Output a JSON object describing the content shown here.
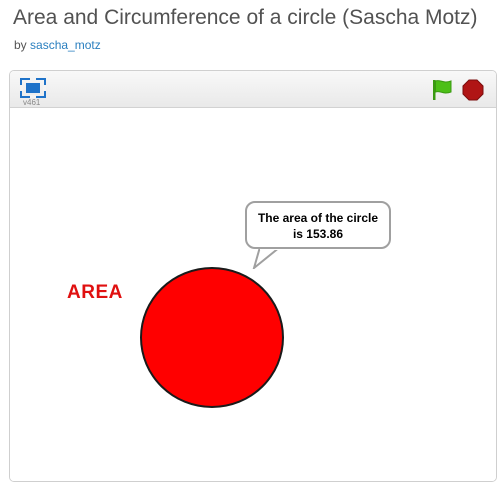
{
  "page": {
    "title": "Area and Circumference of a circle (Sascha Motz)",
    "by_label": "by",
    "author": "sascha_motz"
  },
  "player": {
    "version": "v461",
    "controls": {
      "fullscreen_icon": "fullscreen-icon",
      "flag_icon": "green-flag-icon",
      "stop_icon": "stop-sign-icon",
      "flag_color": "#4cbf17",
      "stop_color": "#b01515"
    },
    "stage": {
      "label": "AREA",
      "label_color": "#e01010",
      "circle_color": "#ff0000",
      "speech": "The area of the circle is 153.86"
    }
  }
}
